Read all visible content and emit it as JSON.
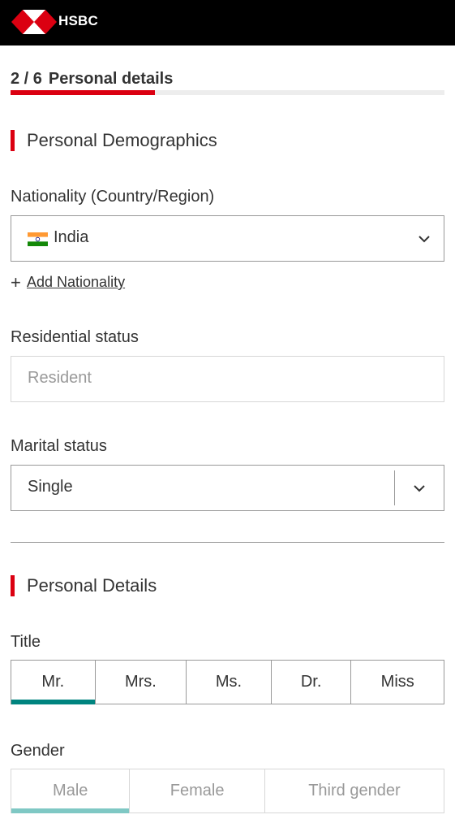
{
  "header": {
    "brand": "HSBC",
    "logo_icon": "hsbc-hexagon-logo"
  },
  "progress": {
    "step_label": "2 / 6",
    "title": "Personal details",
    "fraction": 0.333,
    "fill_color": "#db0011"
  },
  "sections": {
    "demographics": {
      "title": "Personal Demographics"
    },
    "details": {
      "title": "Personal Details"
    }
  },
  "nationality": {
    "label": "Nationality (Country/Region)",
    "value": "India",
    "flag_icon": "india-flag-icon",
    "add_label": "Add Nationality"
  },
  "residential": {
    "label": "Residential status",
    "value": "Resident"
  },
  "marital": {
    "label": "Marital status",
    "value": "Single"
  },
  "title": {
    "label": "Title",
    "options": [
      "Mr.",
      "Mrs.",
      "Ms.",
      "Dr.",
      "Miss"
    ],
    "selected": "Mr."
  },
  "gender": {
    "label": "Gender",
    "options": [
      "Male",
      "Female",
      "Third gender"
    ],
    "selected": "Male"
  },
  "colors": {
    "accent": "#db0011",
    "teal": "#00847f",
    "header_bg": "#000000"
  }
}
